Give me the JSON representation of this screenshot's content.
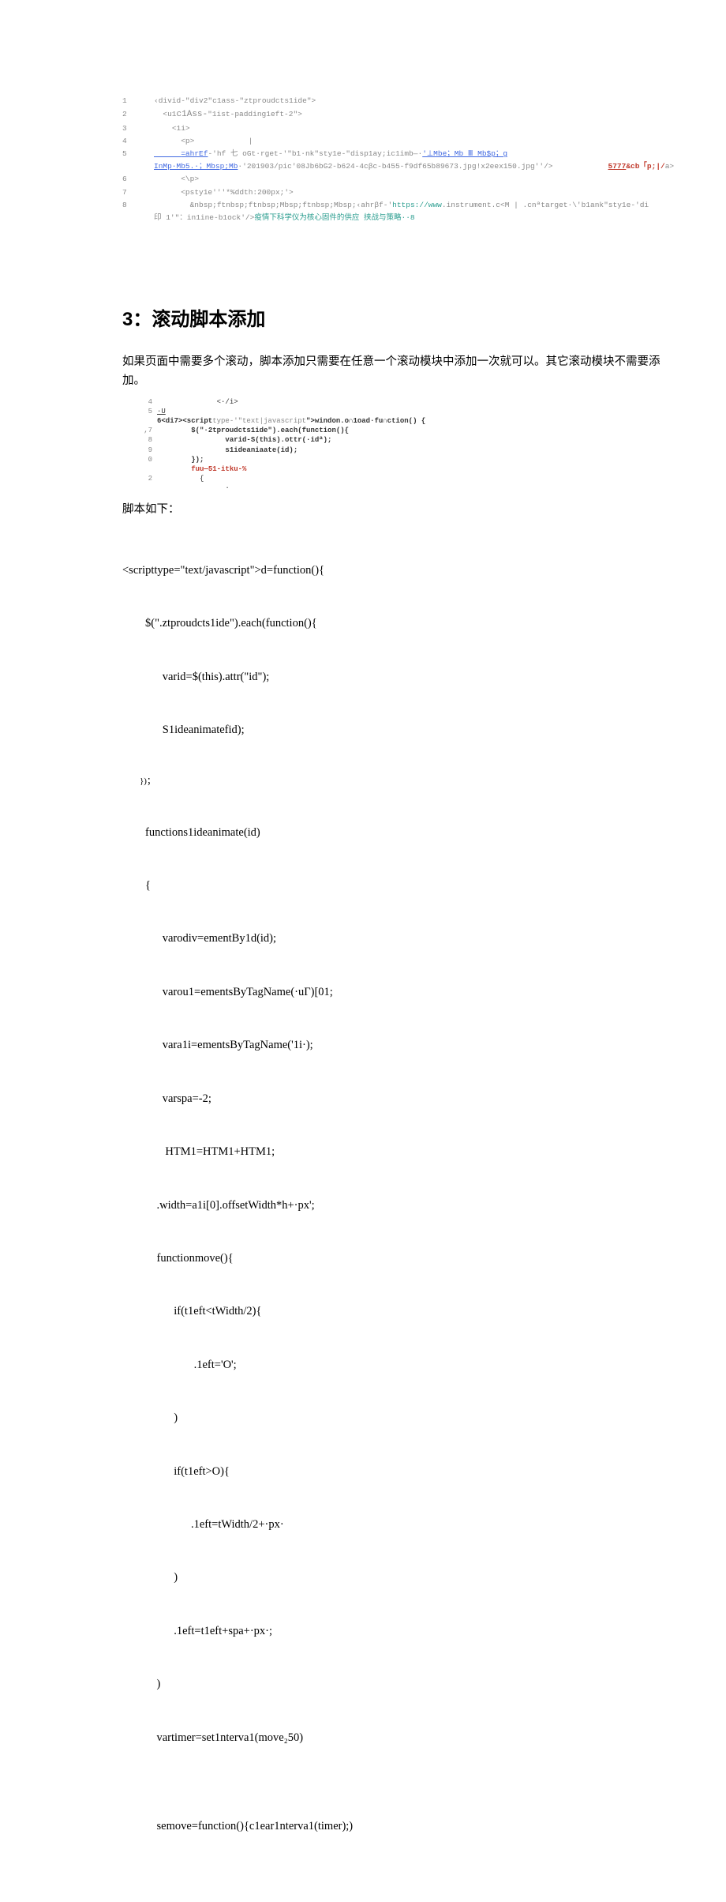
{
  "code1": {
    "r1": {
      "ln": "1",
      "t": "‹divid-\"div2\"c1ass-\"ztproudcts1ide\">"
    },
    "r2": {
      "ln": "2",
      "t": "  <u1"
    },
    "r2a": {
      "t": "c1Ass-"
    },
    "r2b": {
      "t": "\"1ist-padding1eft-2\">"
    },
    "r3": {
      "ln": "3",
      "t": "    <1i>"
    },
    "r4": {
      "ln": "4",
      "t": "      <p>            |"
    },
    "r5": {
      "ln": "5",
      "a": "      =ahrEf",
      "b": "-'hf 七 oGt·rget-'\"b1·nk\"sty1e-\"disp1ay;ic1imb—·",
      "c": "'⊥Mbe；Mb Ⅲ Mb$p；g"
    },
    "r5x": {
      "a": "InMp·Mb5.·；Mbsp;Mb",
      "b": "·'201903/pic'08Jb6bG2-b624-4cβc-b455-f9df65b89673.jpg!x2eex150.jpg''/>"
    },
    "r5r": {
      "t": "5777"
    },
    "r5r2": {
      "t": "&cb「p;|/"
    },
    "r5r3": {
      "t": "a>"
    },
    "r6": {
      "ln": "6",
      "t": "      <\\p>"
    },
    "r7": {
      "ln": "7",
      "t": "      <psty1e'''*%ddth:200px;'>"
    },
    "r8": {
      "ln": "8",
      "t": "        &nbsp;ftnbsp;ftnbsp;Mbsp;ftnbsp;Mbsp;‹ahrβf-'"
    },
    "r8a": {
      "t": "https://www"
    },
    "r8b": {
      "t": ".instrument.c<M | .cnªtarget·\\'b1ank\"sty1e-'di"
    },
    "r9": {
      "a": "印 1'\"：in1ine-b1ock'/>",
      "b": "疫情下科学仪为核心固件的供应 挟战与策略··8"
    }
  },
  "heading": "3：滚动脚本添加",
  "para1": "如果页面中需要多个滚动，脚本添加只需要在任意一个滚动模块中添加一次就可以。其它滚动模块不需要添加。",
  "code2": {
    "r4": {
      "ln": "4",
      "t": "              <·/i>"
    },
    "r5u": {
      "ln": "5",
      "t": "·U"
    },
    "r6": {
      "ln": "",
      "a": "6<di7>",
      "b": "<script",
      "c": "type-'\"text|javascript",
      "d": "\">windon.o∩1oad·fu∩ction() {",
      "e": ""
    },
    "r7": {
      "ln": ",7",
      "t": "        $(\"·2tproudcts1ide\").each(function(){"
    },
    "r8": {
      "ln": "8",
      "t": "                varid-S(this).ottr(·idª);"
    },
    "r9": {
      "ln": "9",
      "t": "                s1ideaniaate(id);"
    },
    "r10": {
      "ln": "0",
      "t": "        });"
    },
    "r11": {
      "ln": "",
      "t": "        fuu—51-itku-%"
    },
    "r12": {
      "ln": "2",
      "t": "          {"
    },
    "r13": {
      "ln": "",
      "t": "                ·"
    }
  },
  "scriptHeader": "脚本如下：",
  "script": {
    "l1": "<scripttype=\"text/javascript\">d=function(){",
    "l2": "        $(\".ztproudcts1ide\").each(function(){",
    "l3": "              varid=$(this).attr(\"id\");",
    "l4": "              S1ideanimatefid);",
    "l5": "        })；",
    "l6": "        functions1ideanimate(id)",
    "l7": "        {",
    "l8": "              varodiv=ementBy1d(id);",
    "l9": "              varou1=ementsByTagName(·uΓ)[01;",
    "l10": "              vara1i=ementsByTagName('1i·);",
    "l11": "              varspa=-2;",
    "l12": "               HTM1=HTM1+HTM1;",
    "l13": "            .width=a1i[0].offsetWidth*h+·px';",
    "l14": "            functionmove(){",
    "l15": "                  if(t1eft<tWidth/2){",
    "l16": "                         .1eft='O';",
    "l17": "                  )",
    "l18": "                  if(t1eft>O){",
    "l19": "                        .1eft=tWidth/2+·px·",
    "l20": "                  )",
    "l21": "                  .1eft=t1eft+spa+·px·;",
    "l22": "            )",
    "l23": "            vartimer=set1nterva1(move₂50)",
    "l24": "",
    "l25": "            semove=function(){c1ear1nterva1(timer);)"
  }
}
